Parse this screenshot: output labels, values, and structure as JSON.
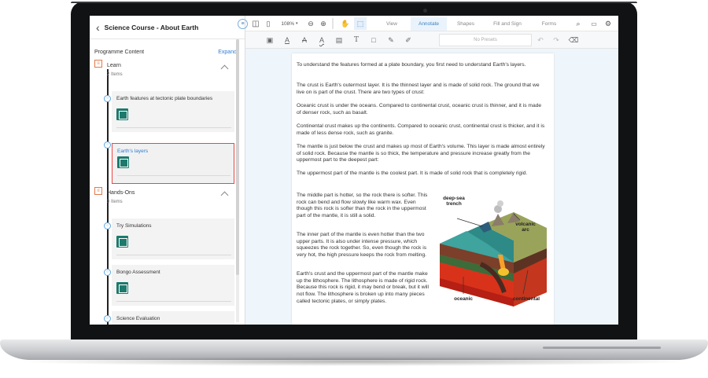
{
  "sidebar": {
    "title": "Science Course - About Earth",
    "programme_label": "Programme Content",
    "expand_label": "Expand",
    "sections": [
      {
        "title": "Learn",
        "count": "2 Items",
        "items": [
          {
            "title": "Earth features at tectonic plate boundaries"
          },
          {
            "title": "Earth's layers",
            "selected": true
          }
        ]
      },
      {
        "title": "Hands-Ons",
        "count": "3 Items",
        "items": [
          {
            "title": "Try Simulations"
          },
          {
            "title": "Bongo Assessment"
          },
          {
            "title": "Science Evaluation"
          }
        ]
      }
    ]
  },
  "toolbar": {
    "zoom": "108%",
    "tabs": [
      "View",
      "Annotate",
      "Shapes",
      "Fill and Sign",
      "Forms"
    ],
    "active_tab": "Annotate",
    "presets_label": "No Presets"
  },
  "document": {
    "paragraphs": [
      "To understand the features formed at a plate boundary, you first need to understand Earth's layers.",
      "The crust is Earth's outermost layer. It is the thinnest layer and is made of solid rock. The ground that we live on is part of the crust. There are two types of crust:",
      "Oceanic crust is under the oceans. Compared to continental crust, oceanic crust is thinner, and it is made of denser rock, such as basalt.",
      "Continental crust makes up the continents. Compared to oceanic crust, continental crust is thicker, and it is made of less dense rock, such as granite.",
      "The mantle is just below the crust and makes up most of Earth's volume. This layer is made almost entirely of solid rock. Because the mantle is so thick, the temperature and pressure increase greatly from the uppermost part to the deepest part:",
      "The uppermost part of the mantle is the coolest part. It is made of solid rock that is completely rigid."
    ],
    "side_paragraphs": [
      "The middle part is hotter, so the rock there is softer. This rock can bend and flow slowly like warm wax. Even though this rock is softer than the rock in the uppermost part of the mantle, it is still a solid.",
      "The inner part of the mantle is even hotter than the two upper parts. It is also under intense pressure, which squeezes the rock together. So, even though the rock is very hot, the high pressure keeps the rock from melting.",
      "Earth's crust and the uppermost part of the mantle make up the lithosphere. The lithosphere is made of rigid rock. Because this rock is rigid, it may bend or break, but it will not flow. The lithosphere is broken up into many pieces called tectonic plates, or simply plates."
    ],
    "diagram_labels": {
      "trench": "deep-sea trench",
      "arc": "volcanic arc",
      "oceanic": "oceanic",
      "continental": "continental"
    }
  },
  "colors": {
    "accent": "#3d7fc4",
    "badge": "#1c7a6d",
    "selection": "#e44444",
    "viewer_bg": "#eef5fb"
  }
}
